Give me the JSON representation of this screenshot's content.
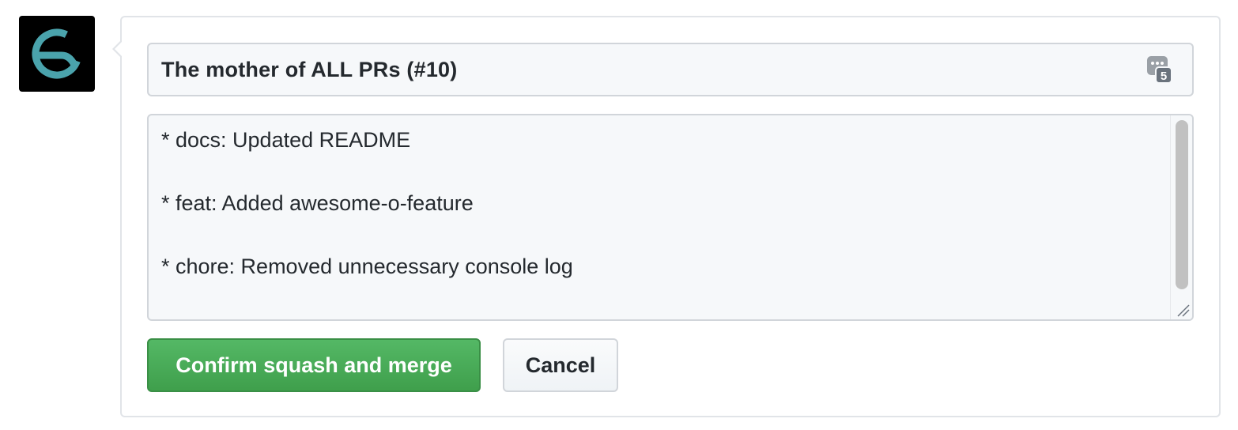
{
  "avatar": {
    "icon": "refresh-circle-logo-icon",
    "accent": "#4aa3ac",
    "background": "#000000"
  },
  "commit_title": "The mother of ALL PRs (#10)",
  "badge": {
    "icon": "password-manager-icon",
    "count": "5"
  },
  "commit_message": {
    "lines": [
      "* docs: Updated README",
      "* feat: Added awesome-o-feature",
      "* chore: Removed unnecessary console log"
    ]
  },
  "buttons": {
    "confirm_label": "Confirm squash and merge",
    "cancel_label": "Cancel"
  },
  "colors": {
    "primary_button": "#43a64f",
    "border": "#e1e4e8",
    "text": "#24292e"
  }
}
